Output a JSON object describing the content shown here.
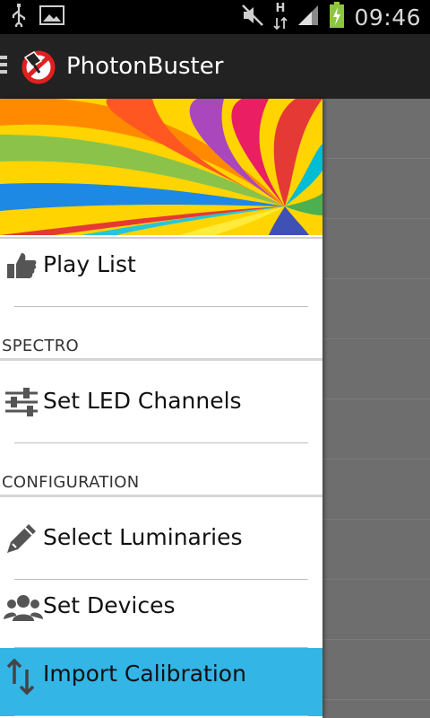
{
  "status_bar": {
    "time": "09:46",
    "network_type": "H",
    "icons": [
      "usb-icon",
      "image-icon",
      "mute-icon",
      "data-arrows-icon",
      "signal-icon",
      "battery-charging-icon"
    ]
  },
  "action_bar": {
    "title": "PhotonBuster",
    "logo": "photonbuster-logo-icon"
  },
  "drawer": {
    "items_top": [
      {
        "label": "Play List",
        "icon": "thumbs-up-icon"
      }
    ],
    "sections": [
      {
        "header": "SPECTRO",
        "items": [
          {
            "label": "Set LED Channels",
            "icon": "sliders-icon"
          }
        ]
      },
      {
        "header": "CONFIGURATION",
        "items": [
          {
            "label": "Select Luminaries",
            "icon": "pencil-icon"
          },
          {
            "label": "Set Devices",
            "icon": "people-icon"
          },
          {
            "label": "Import Calibration",
            "icon": "up-down-arrows-icon",
            "selected": true
          }
        ]
      }
    ]
  },
  "colors": {
    "action_bar": "#222222",
    "selected_item": "#33b5e5",
    "scrim": "#6e6e6e"
  }
}
